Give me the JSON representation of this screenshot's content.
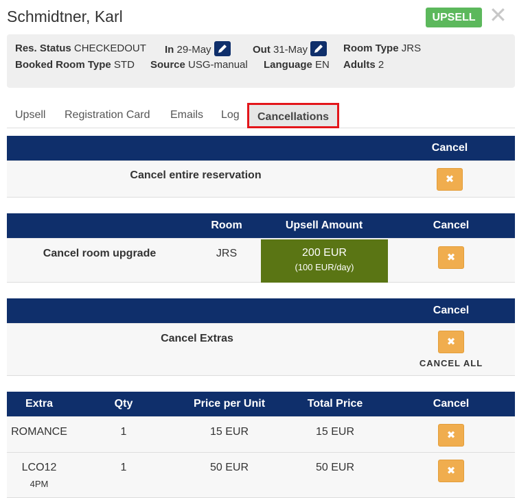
{
  "header": {
    "guest_name": "Schmidtner, Karl",
    "upsell_badge": "UPSELL",
    "close_symbol": "✕"
  },
  "info": {
    "res_status_label": "Res. Status",
    "res_status_value": "CHECKEDOUT",
    "in_label": "In",
    "in_value": "29-May",
    "out_label": "Out",
    "out_value": "31-May",
    "room_type_label": "Room Type",
    "room_type_value": "JRS",
    "booked_room_type_label": "Booked Room Type",
    "booked_room_type_value": "STD",
    "source_label": "Source",
    "source_value": "USG-manual",
    "language_label": "Language",
    "language_value": "EN",
    "adults_label": "Adults",
    "adults_value": "2"
  },
  "tabs": [
    {
      "label": "Upsell",
      "active": false
    },
    {
      "label": "Registration Card",
      "active": false
    },
    {
      "label": "Emails",
      "active": false
    },
    {
      "label": "Log",
      "active": false
    },
    {
      "label": "Cancellations",
      "active": true
    }
  ],
  "reservation_section": {
    "header_cancel": "Cancel",
    "row_label": "Cancel entire reservation",
    "button_symbol": "✖"
  },
  "upgrade_section": {
    "header_room": "Room",
    "header_amount": "Upsell Amount",
    "header_cancel": "Cancel",
    "row_label": "Cancel room upgrade",
    "room": "JRS",
    "amount": "200 EUR",
    "amount_detail": "(100 EUR/day)",
    "amount_color": "#5a7514",
    "button_symbol": "✖"
  },
  "extras_section": {
    "header_cancel": "Cancel",
    "row_label": "Cancel Extras",
    "cancel_all_label": "CANCEL ALL",
    "button_symbol": "✖"
  },
  "extras_table": {
    "headers": {
      "extra": "Extra",
      "qty": "Qty",
      "price_per_unit": "Price per Unit",
      "total_price": "Total Price",
      "cancel": "Cancel"
    },
    "rows": [
      {
        "extra": "ROMANCE",
        "sub": "",
        "qty": "1",
        "unit_price": "15 EUR",
        "total": "15 EUR"
      },
      {
        "extra": "LCO12",
        "sub": "4PM",
        "qty": "1",
        "unit_price": "50 EUR",
        "total": "50 EUR"
      }
    ],
    "button_symbol": "✖"
  },
  "colors": {
    "navy": "#0f2f6b",
    "badge_green": "#5cb85c",
    "cancel_orange": "#f0ad4e",
    "highlight_red": "#e3151a"
  }
}
